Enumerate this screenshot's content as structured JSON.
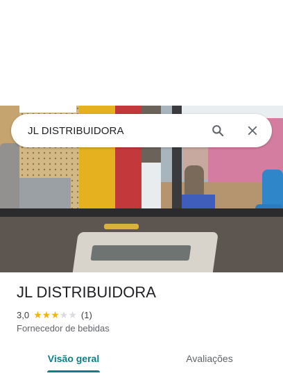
{
  "search": {
    "query": "JL DISTRIBUIDORA",
    "search_icon": "search-icon",
    "close_icon": "close-icon"
  },
  "place": {
    "name": "JL DISTRIBUIDORA",
    "rating": "3,0",
    "rating_stars": 3,
    "rating_max": 5,
    "review_count": "(1)",
    "category": "Fornecedor de bebidas"
  },
  "tabs": [
    {
      "label": "Visão geral",
      "selected": true
    },
    {
      "label": "Avaliações",
      "selected": false
    }
  ],
  "colors": {
    "accent": "#0b7f86",
    "star": "#f5b400"
  }
}
